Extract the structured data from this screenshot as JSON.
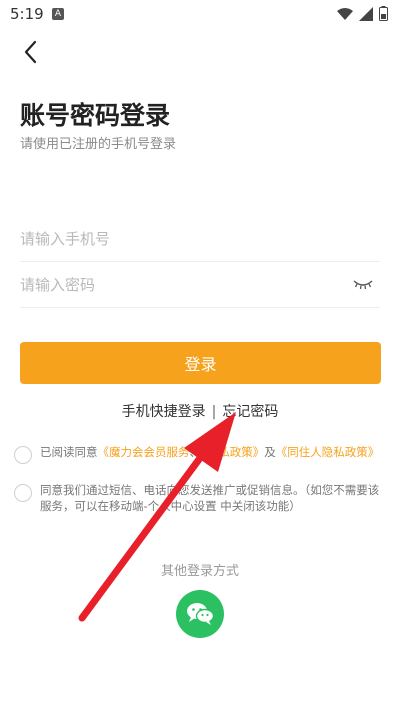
{
  "status_bar": {
    "time": "5:19",
    "icons": [
      "a-notification-icon",
      "wifi-icon",
      "signal-icon",
      "battery-icon"
    ]
  },
  "header": {
    "title": "账号密码登录",
    "subtitle": "请使用已注册的手机号登录"
  },
  "form": {
    "phone_placeholder": "请输入手机号",
    "password_placeholder": "请输入密码",
    "login_label": "登录"
  },
  "links": {
    "quick_login": "手机快捷登录",
    "separator": "|",
    "forgot_password": "忘记密码"
  },
  "agreements": {
    "first": {
      "prefix": "已阅读同意",
      "member_service": "《魔力会会员服务",
      "mid_hidden": "、",
      "privacy": "《隐私政策》",
      "and": "及",
      "guest_privacy": "《同住人隐私政策》"
    },
    "second": {
      "text": "同意我们通过短信、电话向您发送推广或促销信息。（如您不需要该服务，可以在移动端-个人中心设置 中关闭该功能）"
    }
  },
  "other_login": {
    "label": "其他登录方式"
  },
  "colors": {
    "accent": "#f7a21c",
    "wechat": "#2bc163",
    "annotation_arrow": "#e8202a"
  }
}
